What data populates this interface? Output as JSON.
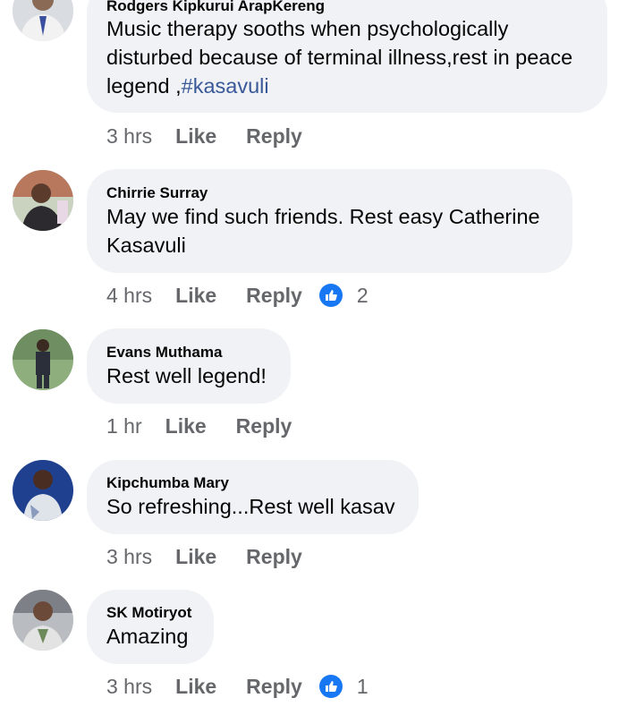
{
  "comments": [
    {
      "author": "Rodgers Kipkurui ArapKereng",
      "text_lines": [
        "Music therapy sooths when psychologically",
        "disturbed because of terminal illness,rest in peace",
        "legend ,"
      ],
      "hashtag": "#kasavuli",
      "time": "3 hrs",
      "like_label": "Like",
      "reply_label": "Reply",
      "reaction_count": null
    },
    {
      "author": "Chirrie Surray",
      "text_lines": [
        "May we find such friends. Rest easy  Catherine",
        "Kasavuli"
      ],
      "time": "4 hrs",
      "like_label": "Like",
      "reply_label": "Reply",
      "reaction_icon": "like-icon",
      "reaction_count": "2"
    },
    {
      "author": "Evans Muthama",
      "text_lines": [
        "Rest well legend!"
      ],
      "time": "1 hr",
      "like_label": "Like",
      "reply_label": "Reply",
      "reaction_count": null
    },
    {
      "author": "Kipchumba Mary",
      "text_lines": [
        "So refreshing...Rest well kasav"
      ],
      "time": "3 hrs",
      "like_label": "Like",
      "reply_label": "Reply",
      "reaction_count": null
    },
    {
      "author": "SK Motiryot",
      "text_lines": [
        "Amazing"
      ],
      "time": "3 hrs",
      "like_label": "Like",
      "reply_label": "Reply",
      "reaction_icon": "like-icon",
      "reaction_count": "1"
    }
  ],
  "colors": {
    "bubble_bg": "#f0f2f5",
    "meta_text": "#65676b",
    "hashtag": "#385898",
    "like_reaction": "#1877f2"
  }
}
